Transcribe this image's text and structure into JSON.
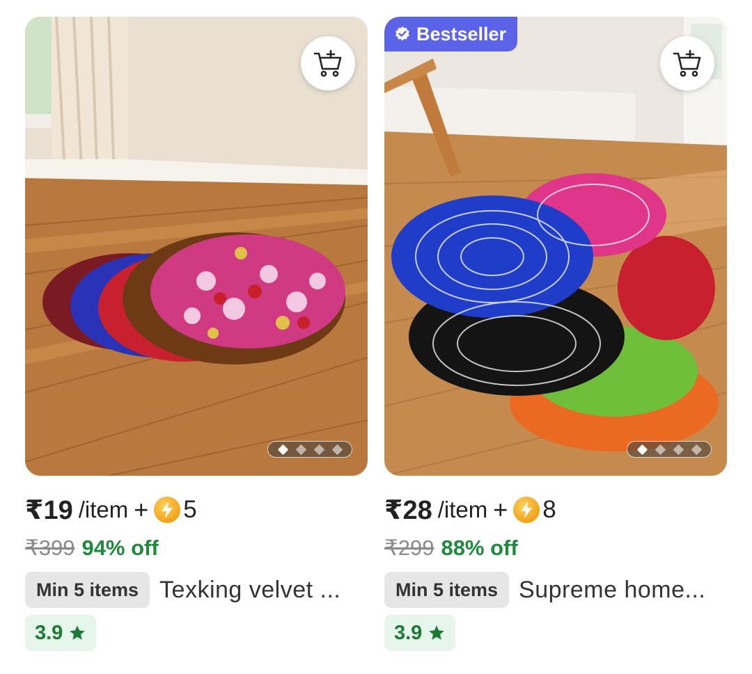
{
  "colors": {
    "accent_badge": "#5b63e8",
    "discount_green": "#1f8a3b",
    "rating_green": "#1b7a34",
    "rating_bg": "#e6f6ea",
    "pill_bg": "#e6e6e6"
  },
  "products": [
    {
      "price": "₹19",
      "unit": "/item",
      "plus": "+",
      "coins": "5",
      "mrp": "₹399",
      "discount": "94% off",
      "min_items": "Min 5 items",
      "title": "Texking velvet ...",
      "rating": "3.9",
      "rating_icon": "star-icon",
      "carousel": {
        "total": 4,
        "active": 1
      },
      "icons": {
        "cart": "add-to-cart-icon",
        "coin": "lightning-coin-icon"
      }
    },
    {
      "badge": "Bestseller",
      "badge_icon": "verified-check-icon",
      "price": "₹28",
      "unit": "/item",
      "plus": "+",
      "coins": "8",
      "mrp": "₹299",
      "discount": "88% off",
      "min_items": "Min 5 items",
      "title": "Supreme home...",
      "rating": "3.9",
      "rating_icon": "star-icon",
      "carousel": {
        "total": 4,
        "active": 1
      },
      "icons": {
        "cart": "add-to-cart-icon",
        "coin": "lightning-coin-icon"
      }
    }
  ]
}
